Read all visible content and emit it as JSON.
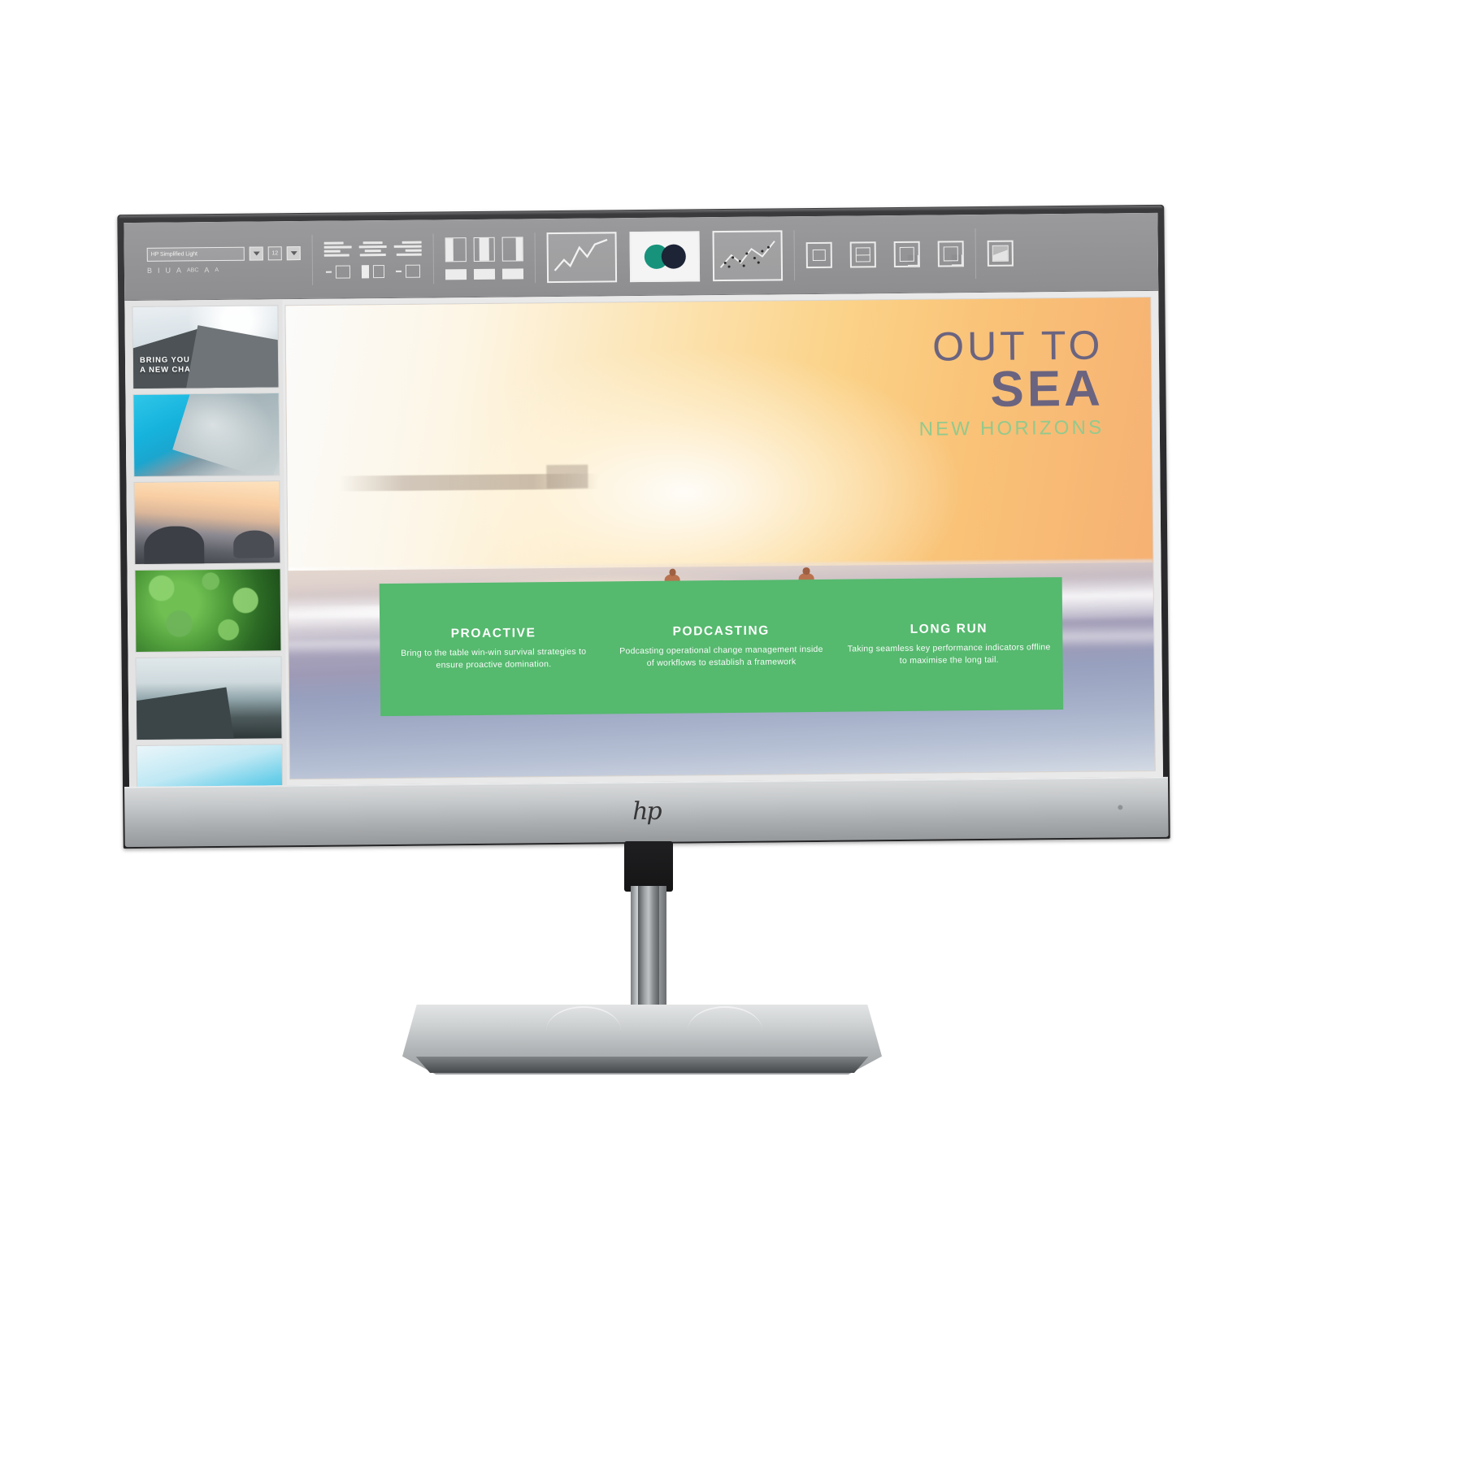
{
  "product": {
    "brand_logo": "hp",
    "type": "desktop-monitor"
  },
  "app": {
    "ribbon": {
      "font_group": {
        "font_name_value": "HP Simplified Light",
        "font_size_value": "12",
        "size_caret_icon": "chevron-down-icon",
        "font_caret_icon": "chevron-down-icon",
        "glyphs": [
          "B",
          "I",
          "U",
          "A",
          "ABC",
          "A",
          "A"
        ]
      },
      "align_group": {
        "align_left_icon": "align-left-icon",
        "align_center_icon": "align-center-icon",
        "align_right_icon": "align-right-icon",
        "indent_icon": "indent-icon",
        "columns_icon": "columns-icon"
      },
      "layout_group": {
        "layout_left_icon": "layout-left-icon",
        "layout_center_icon": "layout-center-icon",
        "layout_right_icon": "layout-right-icon",
        "layout_bottom_a_icon": "layout-bottom-icon",
        "layout_bottom_b_icon": "layout-bottom-icon",
        "layout_bottom_c_icon": "layout-bottom-icon"
      },
      "chart_buttons": {
        "line_chart_icon": "line-chart-icon",
        "color_swatch_icon": "color-swatch-icon",
        "scatter_chart_icon": "scatter-chart-icon"
      },
      "right_group": {
        "frame_icon": "frame-icon",
        "add_slide_icon": "add-slide-icon",
        "duplicate_icon": "duplicate-icon",
        "copy_icon": "copy-icon",
        "picture_icon": "picture-icon"
      },
      "accent_colors": {
        "teal": "#17937c",
        "navy": "#1c2436"
      }
    },
    "thumbnails": [
      {
        "name": "slide-thumb-1",
        "title_line1": "BRING YOU UP",
        "title_line2": "A NEW CHANGE"
      },
      {
        "name": "slide-thumb-2",
        "title_line1": "",
        "title_line2": ""
      },
      {
        "name": "slide-thumb-3",
        "title_line1": "",
        "title_line2": ""
      },
      {
        "name": "slide-thumb-4",
        "title_line1": "",
        "title_line2": ""
      },
      {
        "name": "slide-thumb-5",
        "title_line1": "",
        "title_line2": ""
      },
      {
        "name": "slide-thumb-6",
        "title_line1": "",
        "title_line2": ""
      }
    ],
    "slide": {
      "title_line1": "OUT TO",
      "title_line2": "SEA",
      "subtitle": "NEW HORIZONS",
      "title_color": "#6b6480",
      "subtitle_color": "#93c98d",
      "panel_color": "#55b96e",
      "columns": [
        {
          "heading": "PROACTIVE",
          "body": "Bring to the table win-win survival strategies to ensure proactive domination."
        },
        {
          "heading": "PODCASTING",
          "body": "Podcasting operational change management inside of workflows to establish a framework"
        },
        {
          "heading": "LONG RUN",
          "body": "Taking seamless key performance indicators offline to maximise the long tail."
        }
      ]
    }
  }
}
